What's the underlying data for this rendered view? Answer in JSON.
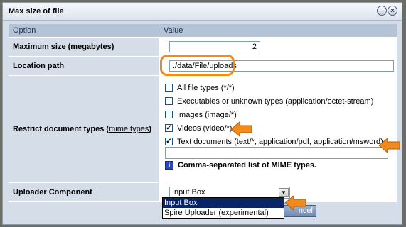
{
  "panel": {
    "title": "Max size of file"
  },
  "table": {
    "header": {
      "option": "Option",
      "value": "Value"
    },
    "max_size": {
      "label": "Maximum size (megabytes)",
      "value": "2"
    },
    "location": {
      "label": "Location path",
      "value": "./data/File/uploads"
    },
    "restrict": {
      "label": "Restrict document types (",
      "link": "mime types",
      "label_end": ")",
      "types": [
        {
          "label": "All file types (*/*)",
          "checked": false
        },
        {
          "label": "Executables or unknown types (application/octet-stream)",
          "checked": false
        },
        {
          "label": "Images (image/*)",
          "checked": false
        },
        {
          "label": "Videos (video/*)",
          "checked": true
        },
        {
          "label": "Text documents (text/*, application/pdf, application/msword)",
          "checked": true
        }
      ],
      "custom_value": "",
      "hint": "Comma-separated list of MIME types.",
      "hint_icon": "info-icon"
    },
    "uploader": {
      "label": "Uploader Component",
      "selected": "Input Box",
      "options": [
        "Input Box",
        "Spire Uploader (experimental)"
      ]
    }
  },
  "footer": {
    "cancel_partial": "ncel"
  },
  "colors": {
    "highlight": "#f28a1c",
    "selection": "#0a246a",
    "panel_bg": "#d4dde8"
  }
}
